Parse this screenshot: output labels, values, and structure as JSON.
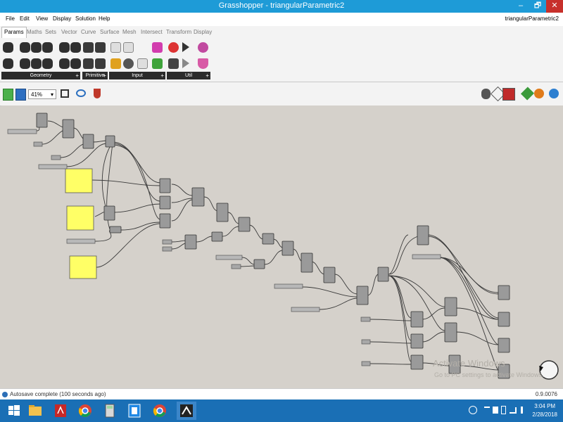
{
  "titlebar": {
    "title": "Grasshopper - triangularParametric2",
    "minimize": "–",
    "restore": "🗗",
    "close": "✕"
  },
  "menu": {
    "items": [
      "File",
      "Edit",
      "View",
      "Display",
      "Solution",
      "Help"
    ],
    "document_name": "triangularParametric2"
  },
  "tabs": [
    "Params",
    "Maths",
    "Sets",
    "Vector",
    "Curve",
    "Surface",
    "Mesh",
    "Intersect",
    "Transform",
    "Display"
  ],
  "active_tab": "Params",
  "ribbon": {
    "groups": [
      {
        "label": "Geometry",
        "plus": "+"
      },
      {
        "label": "Primitive",
        "plus": "+"
      },
      {
        "label": "Input",
        "plus": "+"
      },
      {
        "label": "Util",
        "plus": "+"
      }
    ]
  },
  "canvas_toolbar": {
    "zoom": "41%",
    "zoom_caret": "▾"
  },
  "watermark": {
    "line1": "Activate Windows",
    "line2": "Go to PC settings to activate Windows."
  },
  "statusbar": {
    "message": "Autosave complete (100 seconds ago)",
    "version": "0.9.0076"
  },
  "clock": {
    "time": "3:04 PM",
    "date": "2/28/2018"
  },
  "colors": {
    "titlebar": "#1e9bd7",
    "taskbar": "#1a6fb5",
    "canvas": "#d5d1cb",
    "panel_yellow": "#ffff66"
  }
}
